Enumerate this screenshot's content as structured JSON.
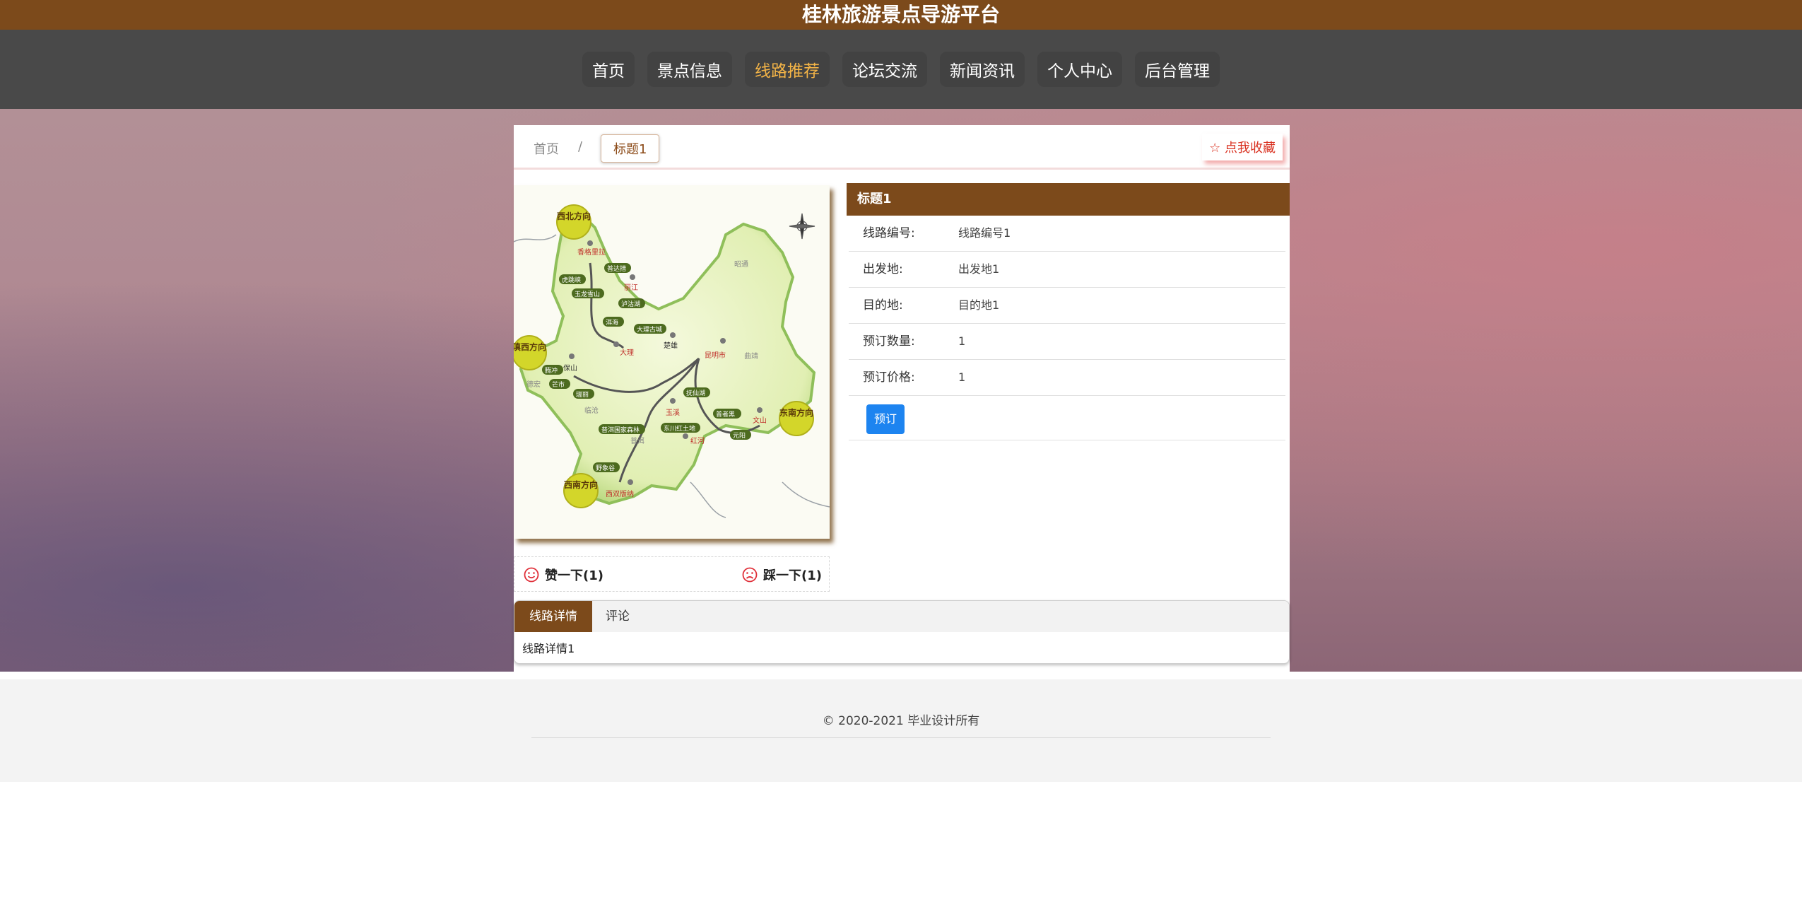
{
  "site": {
    "title": "桂林旅游景点导游平台"
  },
  "nav": {
    "items": [
      {
        "label": "首页",
        "active": false
      },
      {
        "label": "景点信息",
        "active": false
      },
      {
        "label": "线路推荐",
        "active": true
      },
      {
        "label": "论坛交流",
        "active": false
      },
      {
        "label": "新闻资讯",
        "active": false
      },
      {
        "label": "个人中心",
        "active": false
      },
      {
        "label": "后台管理",
        "active": false
      }
    ]
  },
  "breadcrumb": {
    "home": "首页",
    "separator": "/",
    "current": "标题1"
  },
  "favorite": {
    "icon": "star-outline-icon",
    "label": "点我收藏"
  },
  "map": {
    "regions": [
      "西北方向",
      "滇西方向",
      "东南方向",
      "西南方向"
    ],
    "places": [
      "香格里拉",
      "丽江",
      "大理",
      "楚雄",
      "昆明市",
      "保山",
      "玉溪",
      "文山",
      "红河",
      "西双版纳",
      "普洱",
      "临沧",
      "德宏",
      "昭通",
      "曲靖"
    ],
    "spots": [
      "普达措",
      "虎跳峡",
      "玉龙雪山",
      "泸沽湖",
      "洱海",
      "大理古城",
      "腾冲",
      "芒市",
      "瑞丽",
      "抚仙湖",
      "普者黑",
      "东川红土地",
      "普洱国家森林",
      "野象谷",
      "元阳"
    ]
  },
  "votes": {
    "like": {
      "label": "赞一下(1)",
      "icon": "smile-icon"
    },
    "dislike": {
      "label": "踩一下(1)",
      "icon": "frown-icon"
    }
  },
  "info": {
    "title": "标题1",
    "rows": [
      {
        "label": "线路编号:",
        "value": "线路编号1"
      },
      {
        "label": "出发地:",
        "value": "出发地1"
      },
      {
        "label": "目的地:",
        "value": "目的地1"
      },
      {
        "label": "预订数量:",
        "value": "1"
      },
      {
        "label": "预订价格:",
        "value": "1"
      }
    ],
    "book_label": "预订"
  },
  "tabs": {
    "items": [
      "线路详情",
      "评论"
    ],
    "content": "线路详情1"
  },
  "footer": {
    "copyright": "© 2020-2021 毕业设计所有"
  },
  "colors": {
    "brand": "#7c4a1b",
    "nav_bg": "#494949",
    "nav_active": "#f5b547",
    "book_button": "#1d84f0",
    "favorite": "#d9301f"
  }
}
